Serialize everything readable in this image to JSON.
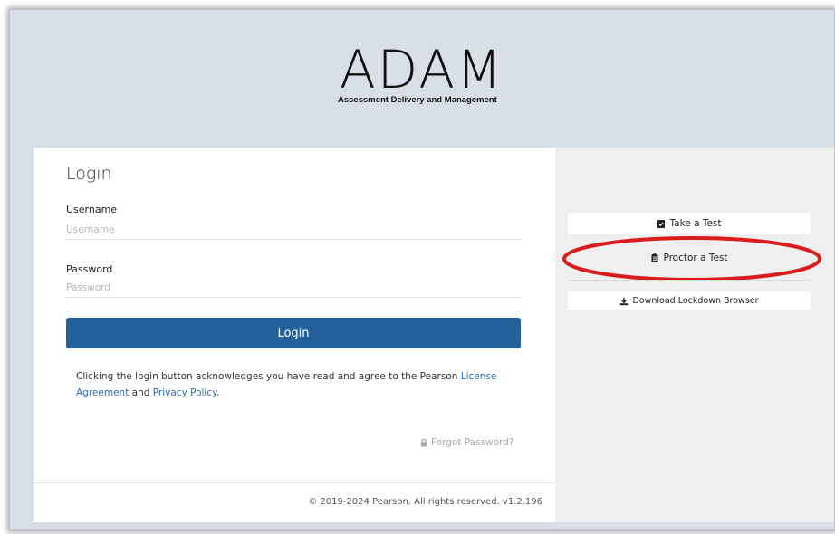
{
  "brand": {
    "logo_word": "ADAM",
    "tagline": "Assessment Delivery and Management"
  },
  "login": {
    "title": "Login",
    "username_label": "Username",
    "username_placeholder": "Username",
    "password_label": "Password",
    "password_placeholder": "Password",
    "submit_label": "Login",
    "legal_prefix": "Clicking the login button acknowledges you have read and agree to the Pearson ",
    "license_link": "License Agreement",
    "legal_and": " and ",
    "privacy_link": "Privacy Policy",
    "legal_suffix": ".",
    "forgot_label": "Forgot Password?"
  },
  "footer": {
    "copyright": "© 2019-2024 Pearson. All rights reserved. v1.2.196"
  },
  "actions": {
    "take_test": "Take a Test",
    "proctor_test": "Proctor a Test",
    "download_browser": "Download Lockdown Browser"
  },
  "icons": {
    "take_test": "clipboard-check-icon",
    "proctor_test": "clipboard-list-icon",
    "download": "download-icon",
    "forgot": "lock-icon"
  },
  "colors": {
    "primary_button": "#24609a",
    "link": "#2a6ab0",
    "highlight": "#d91c1c",
    "page_bg": "#d9dfe6"
  }
}
